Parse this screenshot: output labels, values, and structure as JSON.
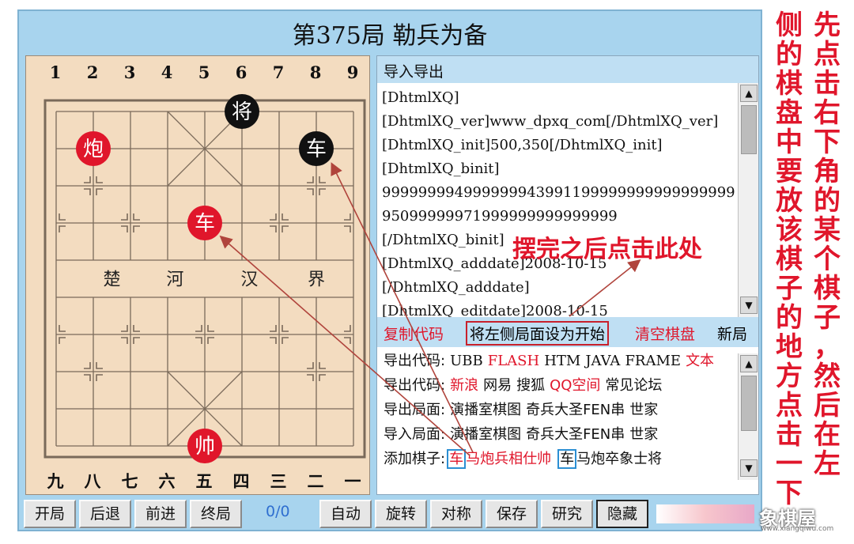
{
  "title": "第375局 勒兵为备",
  "board": {
    "top_numbers": [
      "1",
      "2",
      "3",
      "4",
      "5",
      "6",
      "7",
      "8",
      "9"
    ],
    "bottom_numbers": [
      "九",
      "八",
      "七",
      "六",
      "五",
      "四",
      "三",
      "二",
      "一"
    ],
    "river_text": [
      "楚",
      "河",
      "汉",
      "界"
    ],
    "pieces": [
      {
        "label": "将",
        "side": "black",
        "file": 6,
        "rank": 0
      },
      {
        "label": "车",
        "side": "black",
        "file": 8,
        "rank": 1
      },
      {
        "label": "炮",
        "side": "red",
        "file": 2,
        "rank": 1
      },
      {
        "label": "车",
        "side": "red",
        "file": 5,
        "rank": 3
      },
      {
        "label": "帅",
        "side": "red",
        "file": 5,
        "rank": 9
      }
    ],
    "colors": {
      "board": "#f3dcc0",
      "line": "#7a6a5a",
      "red": "#e0162b",
      "black": "#111111",
      "arrow": "#b0443c"
    }
  },
  "io_panel": {
    "header": "导入导出",
    "code_lines": [
      "[DhtmlXQ]",
      "[DhtmlXQ_ver]www_dpxq_com[/DhtmlXQ_ver]",
      "[DhtmlXQ_init]500,350[/DhtmlXQ_init]",
      "[DhtmlXQ_binit]",
      "999999994999999943991199999999999999999",
      "95099999971999999999999999",
      "[/DhtmlXQ_binit]",
      "[DhtmlXQ_adddate]2008-10-15",
      "[/DhtmlXQ_adddate]",
      "[DhtmlXQ_editdate]2008-10-15"
    ],
    "actions": {
      "copy": "复制代码",
      "set_start": "将左侧局面设为开始",
      "clear": "清空棋盘",
      "new": "新局"
    },
    "export_rows": [
      {
        "label": "导出代码:",
        "items": [
          {
            "t": "UBB",
            "c": "black"
          },
          {
            "t": "FLASH",
            "c": "red"
          },
          {
            "t": "HTM",
            "c": "black"
          },
          {
            "t": "JAVA",
            "c": "black"
          },
          {
            "t": "FRAME",
            "c": "black"
          },
          {
            "t": "文本",
            "c": "red"
          }
        ]
      },
      {
        "label": "导出代码:",
        "items": [
          {
            "t": "新浪",
            "c": "red"
          },
          {
            "t": "网易",
            "c": "black"
          },
          {
            "t": "搜狐",
            "c": "black"
          },
          {
            "t": "QQ空间",
            "c": "red"
          },
          {
            "t": "常见论坛",
            "c": "black"
          }
        ]
      },
      {
        "label": "导出局面:",
        "items": [
          {
            "t": "演播室棋图",
            "c": "black"
          },
          {
            "t": "奇兵大圣FEN串",
            "c": "black"
          },
          {
            "t": "世家",
            "c": "black"
          }
        ]
      },
      {
        "label": "导入局面:",
        "items": [
          {
            "t": "演播室棋图",
            "c": "black"
          },
          {
            "t": "奇兵大圣FEN串",
            "c": "black"
          },
          {
            "t": "世家",
            "c": "black"
          }
        ]
      }
    ],
    "add_piece_label": "添加棋子:",
    "red_pieces_selected": "车",
    "red_pieces_rest": "马炮兵相仕帅",
    "black_pieces_selected": "车",
    "black_pieces_rest": "马炮卒象士将"
  },
  "toolbar": {
    "start": "开局",
    "back": "后退",
    "forward": "前进",
    "end": "终局",
    "counter": "0/0",
    "auto": "自动",
    "rotate": "旋转",
    "mirror": "对称",
    "save": "保存",
    "study": "研究",
    "hide": "隐藏"
  },
  "annotation": "摆完之后点击此处",
  "side_note_col1": "先点击右下角的某个棋子，然后在左",
  "side_note_col2": "侧的棋盘中要放该棋子的地方点击一下",
  "watermark": "象棋屋",
  "watermark_sub": "www.xiangqiwu.com"
}
